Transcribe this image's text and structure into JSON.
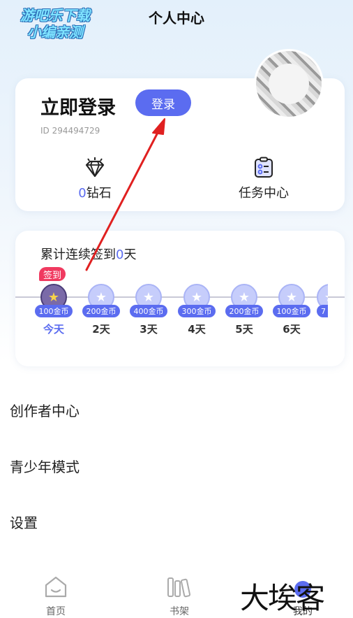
{
  "watermark_top": {
    "line1": "游吧乐下载",
    "line2": "小编亲测"
  },
  "header": {
    "title": "个人中心"
  },
  "profile": {
    "login_title": "立即登录",
    "login_button": "登录",
    "user_id": "ID 294494729",
    "diamond_count": "0",
    "diamond_label": "钻石",
    "task_label": "任务中心"
  },
  "signin": {
    "title_prefix": "累计连续签到",
    "title_count": "0",
    "title_suffix": "天",
    "badge": "签到",
    "days": [
      {
        "reward": "100金币",
        "label": "今天"
      },
      {
        "reward": "200金币",
        "label": "2天"
      },
      {
        "reward": "400金币",
        "label": "3天"
      },
      {
        "reward": "300金币",
        "label": "4天"
      },
      {
        "reward": "200金币",
        "label": "5天"
      },
      {
        "reward": "100金币",
        "label": "6天"
      },
      {
        "reward": "7",
        "label": ""
      }
    ]
  },
  "menu": {
    "creator": "创作者中心",
    "youth": "青少年模式",
    "settings": "设置"
  },
  "tabbar": {
    "home": "首页",
    "bookshelf": "书架",
    "mine": "我的"
  },
  "watermark_bottom": "大埃客",
  "colors": {
    "accent": "#5b6cf0",
    "badge": "#f03a60",
    "arrow": "#e02020"
  }
}
